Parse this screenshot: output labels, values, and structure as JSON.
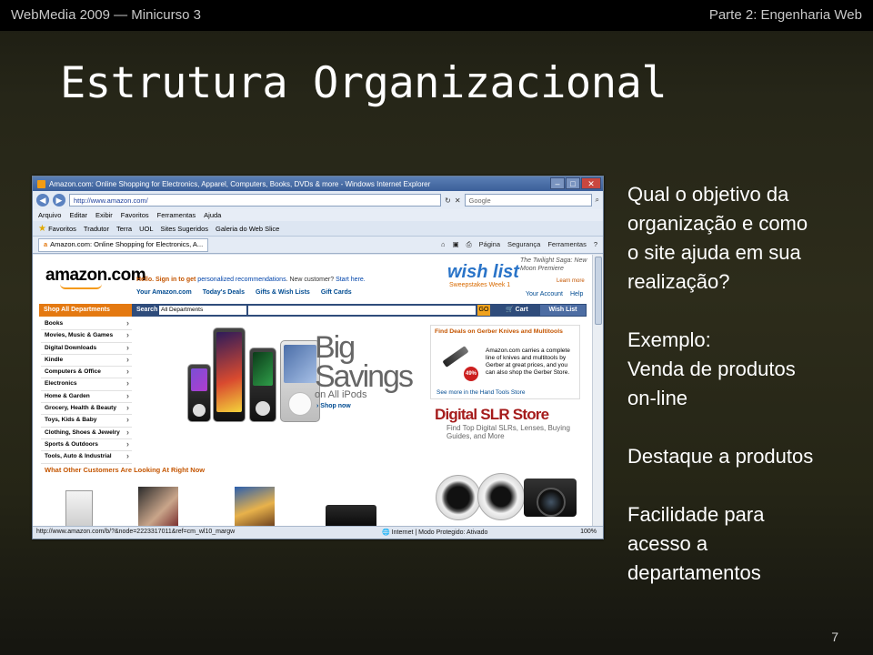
{
  "header": {
    "left": "WebMedia 2009 — Minicurso 3",
    "right": "Parte 2: Engenharia Web"
  },
  "title": "Estrutura Organizacional",
  "browser": {
    "window_title": "Amazon.com: Online Shopping for Electronics, Apparel, Computers, Books, DVDs & more - Windows Internet Explorer",
    "address": "http://www.amazon.com/",
    "search_placeholder": "Google",
    "menu": [
      "Arquivo",
      "Editar",
      "Exibir",
      "Favoritos",
      "Ferramentas",
      "Ajuda"
    ],
    "favorites": [
      "Favoritos",
      "Tradutor",
      "Terra",
      "UOL",
      "Sites Sugeridos",
      "Galeria do Web Slice"
    ],
    "tab": "Amazon.com: Online Shopping for Electronics, A...",
    "tab_tools": [
      "Página",
      "Segurança",
      "Ferramentas"
    ],
    "status_url": "http://www.amazon.com/b/?&node=2223317011&ref=cm_wl10_margw",
    "status_zone": "Internet | Modo Protegido: Ativado",
    "zoom": "100%",
    "page": {
      "logo": "amazon.com",
      "hello": "Hello. Sign in to get",
      "hello_link": "personalized recommendations",
      "hello_rest": ". New customer?",
      "start_here": "Start here.",
      "nav_links": [
        "Your Amazon.com",
        "Today's Deals",
        "Gifts & Wish Lists",
        "Gift Cards"
      ],
      "wishlist_logo": "wish list",
      "sweepstakes": "Sweepstakes Week 1",
      "twilight": "The Twilight Saga: New Moon Premiere",
      "learn_more": "Learn more",
      "account_links": [
        "Your Account",
        "Help"
      ],
      "shop_all": "Shop All Departments",
      "search_label": "Search",
      "dept_select": "All Departments",
      "go": "GO",
      "cart": "Cart",
      "wish_list_btn": "Wish List",
      "categories": [
        "Books",
        "Movies, Music & Games",
        "Digital Downloads",
        "Kindle",
        "Computers & Office",
        "Electronics",
        "Home & Garden",
        "Grocery, Health & Beauty",
        "Toys, Kids & Baby",
        "Clothing, Shoes & Jewelry",
        "Sports & Outdoors",
        "Tools, Auto & Industrial"
      ],
      "big_savings": [
        "Big",
        "Savings"
      ],
      "on_all_ipods": "on All iPods",
      "shop_now": "Shop now",
      "gerber_heading": "Find Deals on Gerber Knives and Multitools",
      "gerber_text": "Amazon.com carries a complete line of knives and multitools by Gerber at great prices, and you can also shop the Gerber Store.",
      "gerber_more": "See more in the Hand Tools Store",
      "gerber_badge": "49%",
      "dslr_title": "Digital SLR Store",
      "dslr_sub": "Find Top Digital SLRs, Lenses, Buying Guides, and More",
      "others_looking": "What Other Customers Are Looking At Right Now"
    }
  },
  "right_text": {
    "question": [
      "Qual o objetivo da",
      "organização e como",
      "o site ajuda em sua",
      "realização?"
    ],
    "example": [
      "Exemplo:",
      "Venda de produtos",
      "on-line"
    ],
    "highlight": "Destaque a produtos",
    "ease": [
      "Facilidade para",
      "acesso a",
      "departamentos"
    ]
  },
  "page_number": "7",
  "colors": {
    "background": "#2d2c1b",
    "header_bar": "#000000",
    "title_text": "#ffffff",
    "amazon_orange": "#e47911",
    "amazon_nav": "#2f4c7b"
  }
}
